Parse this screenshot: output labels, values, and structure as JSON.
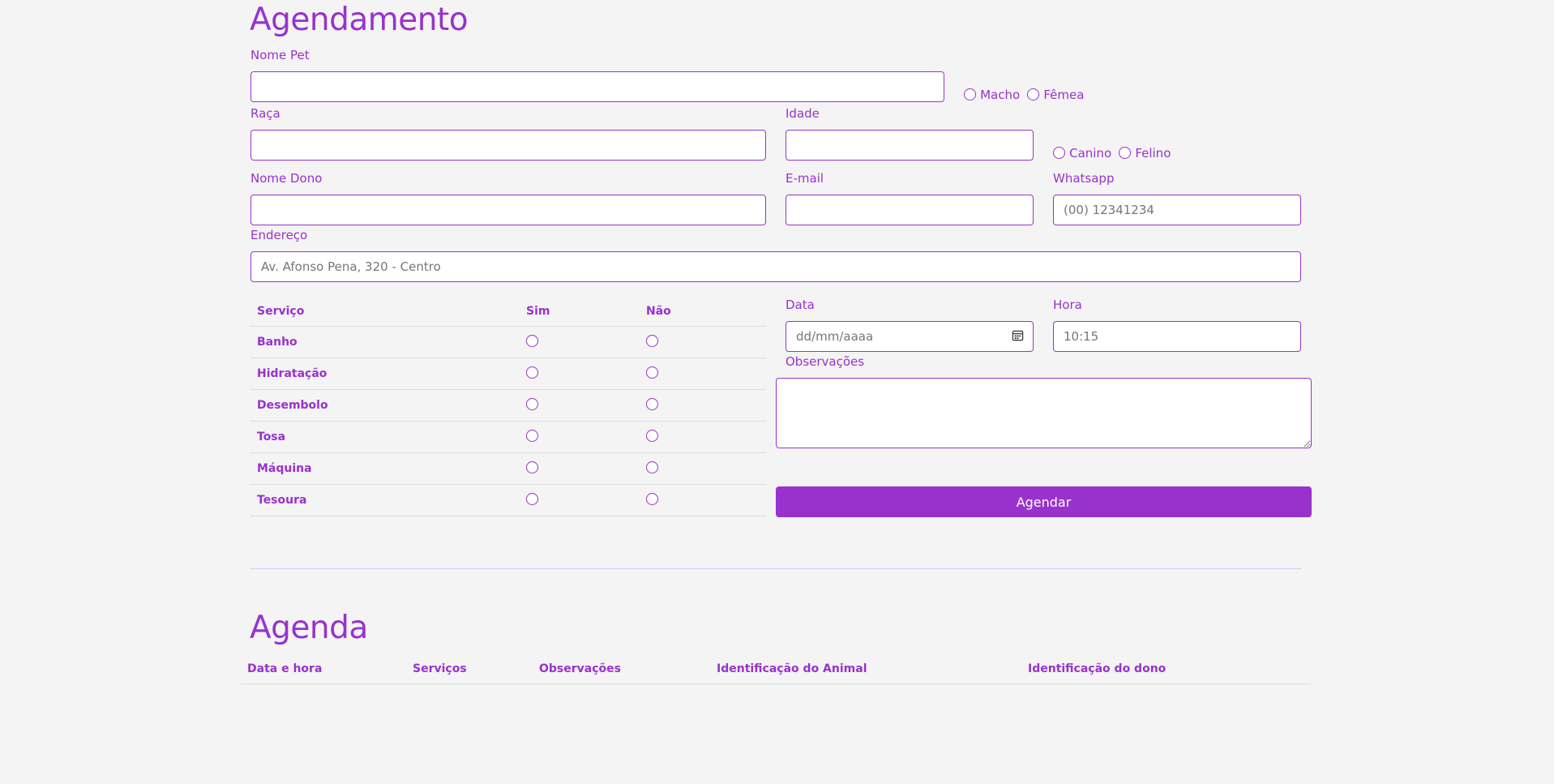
{
  "form": {
    "title": "Agendamento",
    "pet_name_label": "Nome Pet",
    "pet_name_value": "",
    "sex_options": [
      "Macho",
      "Fêmea"
    ],
    "breed_label": "Raça",
    "age_label": "Idade",
    "species_options": [
      "Canino",
      "Felino"
    ],
    "owner_label": "Nome Dono",
    "email_label": "E-mail",
    "whatsapp_label": "Whatsapp",
    "whatsapp_placeholder": "(00) 12341234",
    "address_label": "Endereço",
    "address_placeholder": "Av. Afonso Pena, 320 - Centro",
    "date_label": "Data",
    "date_placeholder": "dd/mm/aaaa",
    "time_label": "Hora",
    "time_placeholder": "10:15",
    "notes_label": "Observações",
    "submit_label": "Agendar"
  },
  "services": {
    "headers": [
      "Serviço",
      "Sim",
      "Não"
    ],
    "items": [
      "Banho",
      "Hidratação",
      "Desembolo",
      "Tosa",
      "Máquina",
      "Tesoura"
    ]
  },
  "agenda": {
    "title": "Agenda",
    "columns": [
      "Data e hora",
      "Serviços",
      "Observações",
      "Identificação do Animal",
      "Identificação do dono"
    ]
  },
  "colors": {
    "accent": "#9932cc",
    "background": "#f4f4f4"
  },
  "icons": {
    "date_picker": "calendar-icon"
  }
}
